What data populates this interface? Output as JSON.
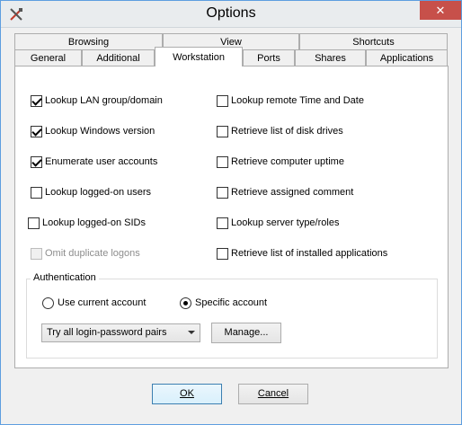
{
  "window": {
    "title": "Options",
    "close_glyph": "✕",
    "icon": "tools-icon"
  },
  "tabs_top": [
    "Browsing",
    "View",
    "Shortcuts"
  ],
  "tabs_bottom": [
    "General",
    "Additional",
    "Workstation",
    "Ports",
    "Shares",
    "Applications"
  ],
  "active_tab": "Workstation",
  "left_checks": [
    {
      "label": "Lookup LAN group/domain",
      "checked": true,
      "disabled": false
    },
    {
      "label": "Lookup Windows version",
      "checked": true,
      "disabled": false
    },
    {
      "label": "Enumerate user accounts",
      "checked": true,
      "disabled": false
    },
    {
      "label": "Lookup logged-on users",
      "checked": false,
      "disabled": false
    },
    {
      "label": "Lookup logged-on SIDs",
      "checked": false,
      "disabled": false
    },
    {
      "label": "Omit duplicate logons",
      "checked": false,
      "disabled": true
    }
  ],
  "right_checks": [
    {
      "label": "Lookup remote Time and Date",
      "checked": false
    },
    {
      "label": "Retrieve list of disk drives",
      "checked": false
    },
    {
      "label": "Retrieve computer uptime",
      "checked": false
    },
    {
      "label": "Retrieve assigned comment",
      "checked": false
    },
    {
      "label": "Lookup server type/roles",
      "checked": false
    },
    {
      "label": "Retrieve list of installed applications",
      "checked": false
    }
  ],
  "auth": {
    "title": "Authentication",
    "use_current": "Use current account",
    "specific": "Specific account",
    "selected": "specific",
    "login_option": "Try all login-password pairs",
    "manage_label": "Manage..."
  },
  "footer": {
    "ok_label": "OK",
    "cancel_label": "Cancel"
  }
}
